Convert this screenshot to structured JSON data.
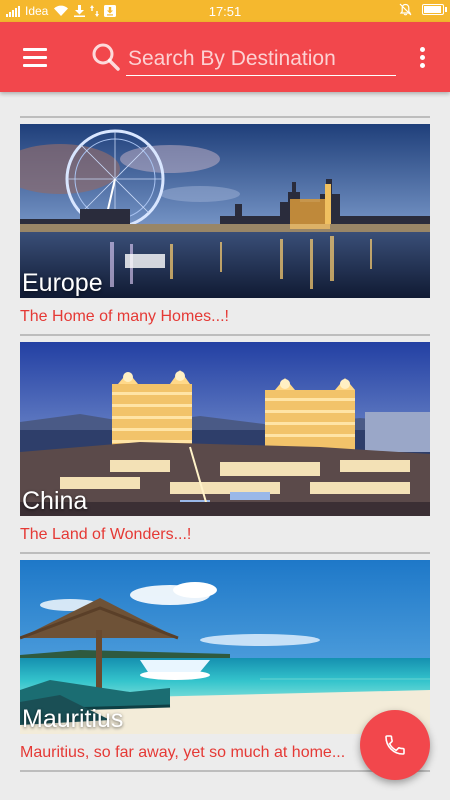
{
  "status_bar": {
    "carrier": "Idea",
    "time": "17:51"
  },
  "app_bar": {
    "search_placeholder": "Search By Destination"
  },
  "destinations": [
    {
      "name": "Europe",
      "tagline": "The Home of many Homes...!"
    },
    {
      "name": "China",
      "tagline": "The Land of Wonders...!"
    },
    {
      "name": "Mauritius",
      "tagline": "Mauritius, so far away, yet so much at home..."
    }
  ],
  "colors": {
    "status_bar": "#f5b82e",
    "app_bar": "#f2474c",
    "tagline": "#e53935",
    "fab": "#f2474c"
  },
  "icons": {
    "menu": "menu-icon",
    "search": "search-icon",
    "more": "more-vert-icon",
    "fab": "phone-icon"
  }
}
